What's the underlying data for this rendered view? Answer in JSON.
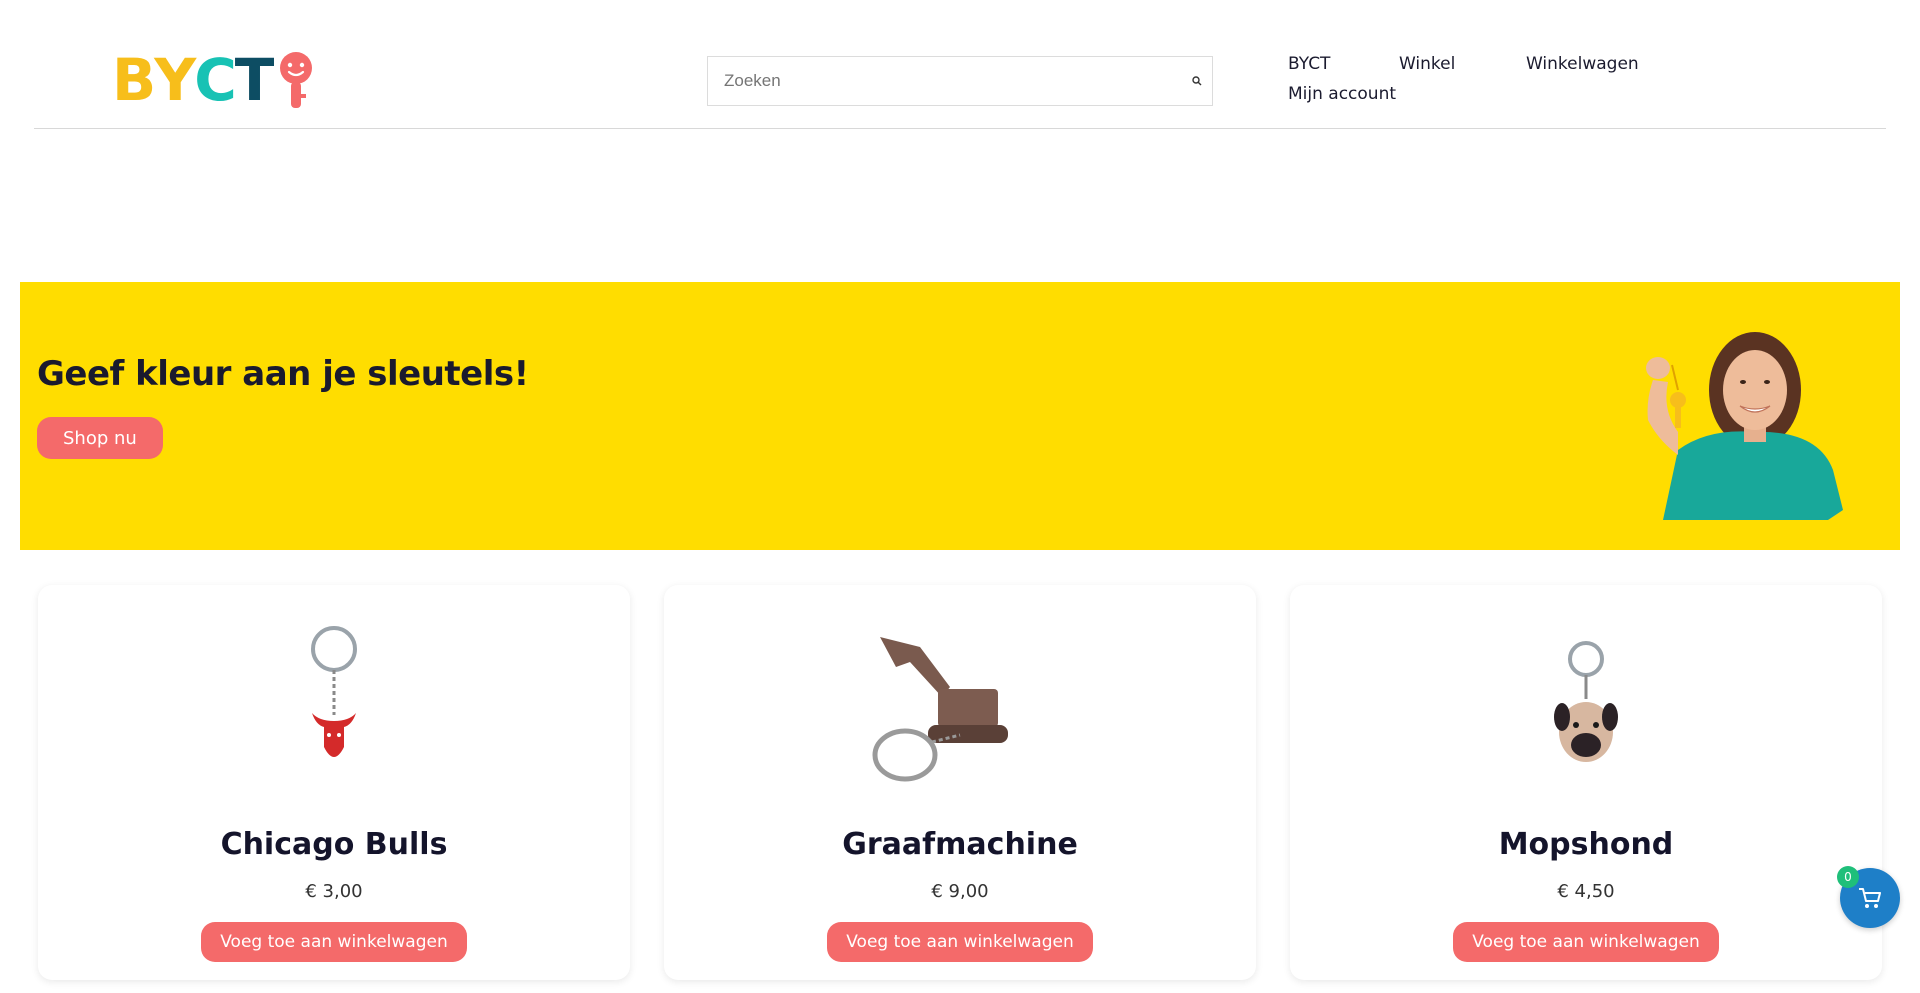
{
  "header": {
    "logo": {
      "letters": [
        "B",
        "Y",
        "C",
        "T"
      ],
      "colors": [
        "#f7be1b",
        "#f7be1b",
        "#18c2b4",
        "#0d4d63"
      ],
      "key_color": "#f46a6a",
      "icon": "key-smiley-icon"
    },
    "search": {
      "placeholder": "Zoeken",
      "value": "",
      "icon": "search-icon"
    },
    "nav": [
      {
        "label": "BYCT"
      },
      {
        "label": "Winkel"
      },
      {
        "label": "Winkelwagen"
      },
      {
        "label": "Mijn account"
      }
    ]
  },
  "hero": {
    "title": "Geef kleur aan je sleutels!",
    "button_label": "Shop nu",
    "background": "#ffdd00",
    "image": "woman-holding-keychain"
  },
  "products": [
    {
      "name": "Chicago Bulls",
      "price": "€ 3,00",
      "button_label": "Voeg toe aan winkelwagen",
      "image": "chicago-bulls-keychain"
    },
    {
      "name": "Graafmachine",
      "price": "€ 9,00",
      "button_label": "Voeg toe aan winkelwagen",
      "image": "excavator-keychain"
    },
    {
      "name": "Mopshond",
      "price": "€ 4,50",
      "button_label": "Voeg toe aan winkelwagen",
      "image": "pug-keychain"
    }
  ],
  "cart_fab": {
    "count": "0",
    "icon": "cart-icon"
  },
  "colors": {
    "accent": "#f46a6a",
    "cart_blue": "#1e7fc8",
    "badge_green": "#1fbf7a"
  }
}
